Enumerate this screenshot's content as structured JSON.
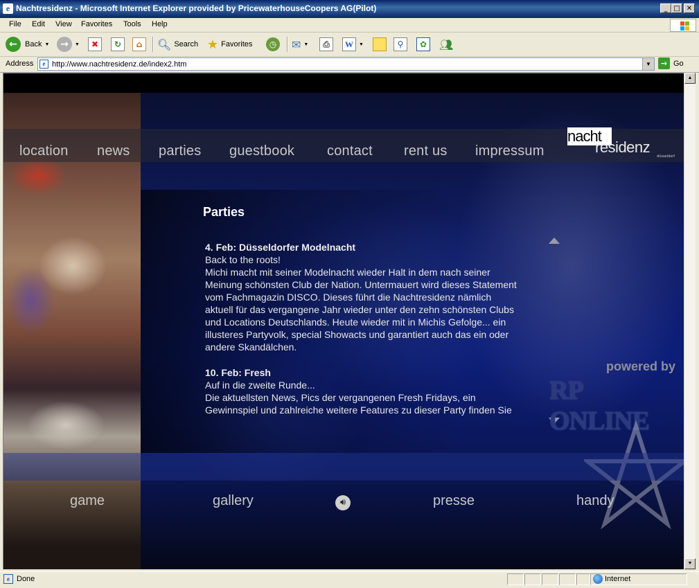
{
  "window": {
    "title": "Nachtresidenz - Microsoft Internet Explorer provided by PricewaterhouseCoopers AG(Pilot)",
    "controls": {
      "minimize": "_",
      "maximize": "□",
      "close": "✕"
    }
  },
  "menu": [
    "File",
    "Edit",
    "View",
    "Favorites",
    "Tools",
    "Help"
  ],
  "toolbar": {
    "back": "Back",
    "search": "Search",
    "favorites": "Favorites"
  },
  "address": {
    "label": "Address",
    "url": "http://www.nachtresidenz.de/index2.htm",
    "go": "Go"
  },
  "site": {
    "nav": [
      "location",
      "news",
      "parties",
      "guestbook",
      "contact",
      "rent us",
      "impressum"
    ],
    "logo": {
      "top": "nacht",
      "bottom": "residenz",
      "sub": "düsseldorf"
    },
    "page_title": "Parties",
    "articles": [
      {
        "heading": "4. Feb: Düsseldorfer Modelnacht",
        "lines": [
          "Back to the roots!",
          "Michi macht mit seiner Modelnacht wieder Halt in dem nach seiner",
          "Meinung schönsten Club der Nation. Untermauert wird dieses Statement",
          "vom Fachmagazin DISCO. Dieses führt die Nachtresidenz nämlich",
          "aktuell für das vergangene Jahr wieder unter den zehn schönsten Clubs",
          "und Locations Deutschlands. Heute wieder mit in Michis Gefolge...  ein",
          "illusteres Partyvolk, special Showacts und garantiert auch das ein oder",
          "andere Skandälchen."
        ]
      },
      {
        "heading": "10. Feb: Fresh",
        "lines": [
          "Auf in die zweite Runde...",
          "Die aktuellsten News, Pics der vergangenen Fresh Fridays, ein",
          "Gewinnspiel und zahlreiche weitere Features zu dieser Party finden Sie"
        ]
      }
    ],
    "powered_by": "powered by",
    "sponsor": "RP ONLINE",
    "bottom_nav": [
      "game",
      "gallery",
      "presse",
      "handy"
    ]
  },
  "status": {
    "text": "Done",
    "zone": "Internet"
  }
}
